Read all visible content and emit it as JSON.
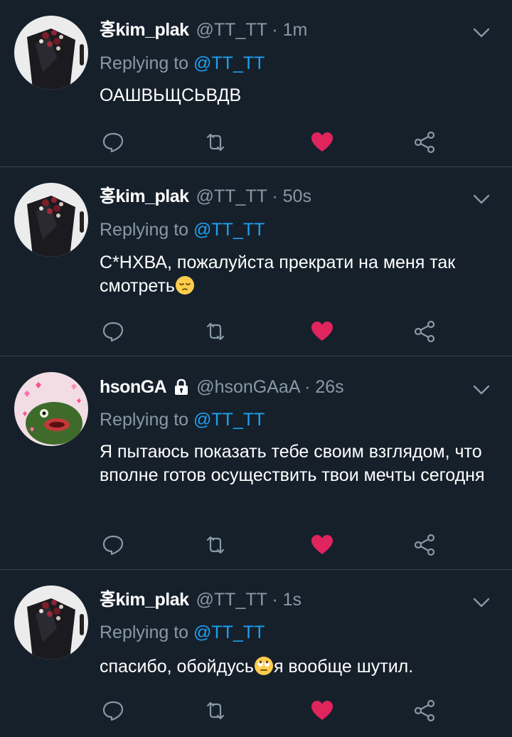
{
  "tweets": [
    {
      "display_name": "홍kim_plak",
      "handle": "@TT_TT",
      "time": "1m",
      "reply_prefix": "Replying to",
      "reply_to": "@TT_TT",
      "text": "ОАШВЬЩСЬВДВ",
      "liked": true,
      "protected": false,
      "avatar": "bouquet"
    },
    {
      "display_name": "홍kim_plak",
      "handle": "@TT_TT",
      "time": "50s",
      "reply_prefix": "Replying to",
      "reply_to": "@TT_TT",
      "text": "С*НХВА, пожалуйста прекрати на меня так смотреть",
      "text_emoji": "pensive-face-emoji",
      "liked": true,
      "protected": false,
      "avatar": "bouquet"
    },
    {
      "display_name": "hsonGA",
      "handle": "@hsonGAaA",
      "time": "26s",
      "reply_prefix": "Replying to",
      "reply_to": "@TT_TT",
      "text": "Я пытаюсь показать тебе своим взглядом, что вполне готов осуществить твои мечты сегодня",
      "liked": true,
      "protected": true,
      "avatar": "kermit-hearts"
    },
    {
      "display_name": "홍kim_plak",
      "handle": "@TT_TT",
      "time": "1s",
      "reply_prefix": "Replying to",
      "reply_to": "@TT_TT",
      "text_before": "спасибо, обойдусь",
      "text_emoji": "rolling-eyes-emoji",
      "text_after": "я вообще шутил.",
      "liked": true,
      "protected": false,
      "avatar": "bouquet"
    }
  ],
  "separator": " · ",
  "colors": {
    "background": "#15202b",
    "divider": "#38444d",
    "secondary_text": "#8899a6",
    "mention": "#1da1f2",
    "like_active": "#e0245e"
  },
  "icons": {
    "reply": "reply-icon",
    "retweet": "retweet-icon",
    "like": "heart-icon",
    "share": "share-icon",
    "menu": "chevron-down-icon",
    "protected": "lock-icon"
  }
}
